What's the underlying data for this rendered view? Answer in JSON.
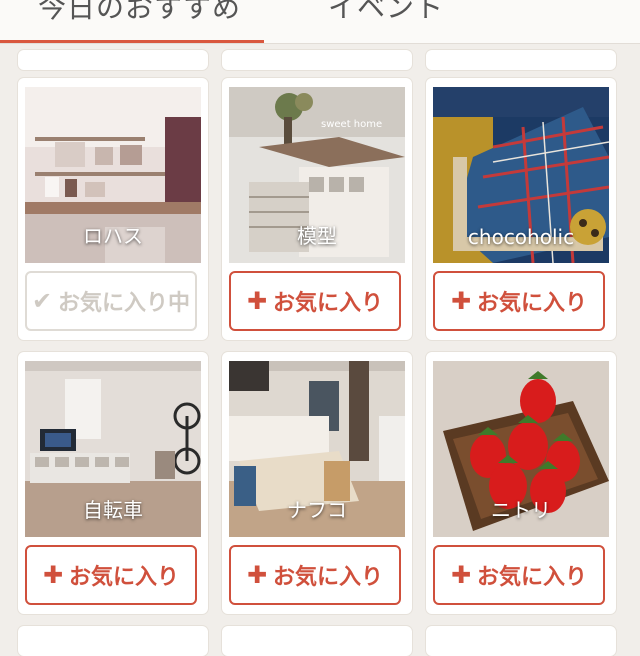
{
  "header": {
    "title": "今日のおすすめ　　　イベント"
  },
  "cards": [
    {
      "label": "ロハス",
      "button": "お気に入り中",
      "favorited": true
    },
    {
      "label": "模型",
      "photo_text": "sweet home",
      "button": "お気に入り",
      "favorited": false
    },
    {
      "label": "chocoholic",
      "button": "お気に入り",
      "favorited": false
    },
    {
      "label": "自転車",
      "button": "お気に入り",
      "favorited": false
    },
    {
      "label": "ナフコ",
      "button": "お気に入り",
      "favorited": false
    },
    {
      "label": "ニトリ",
      "button": "お気に入り",
      "favorited": false
    }
  ],
  "icons": {
    "add": "plus-icon",
    "added": "check-icon"
  },
  "colors": {
    "accent": "#d0503c",
    "muted": "#cfcac3",
    "background": "#f1eeea"
  }
}
